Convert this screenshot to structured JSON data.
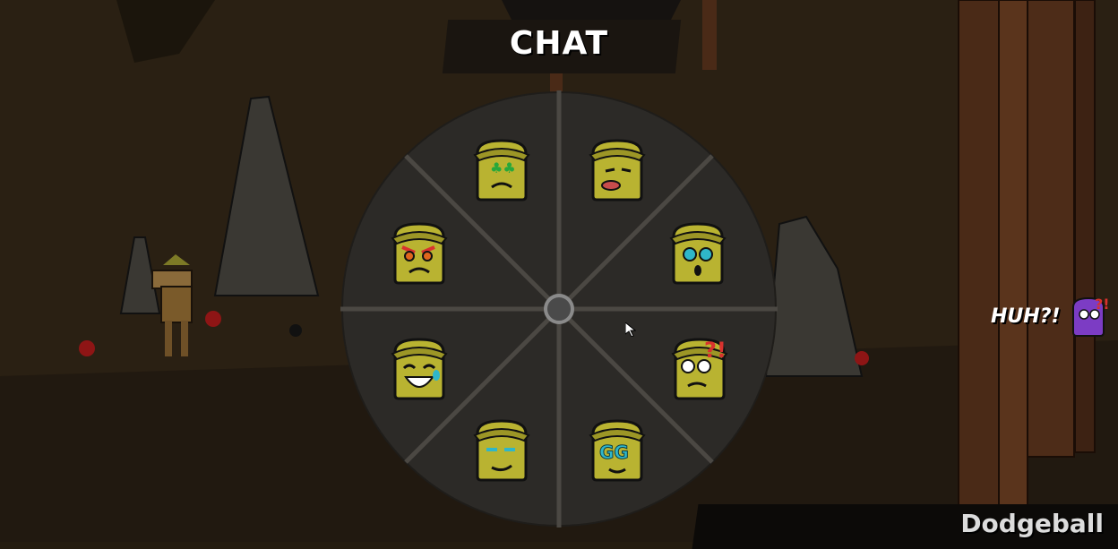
{
  "title": "CHAT",
  "game_mode": "Dodgeball",
  "chat_bubble": {
    "text": "HUH?!",
    "avatar": "purple-confused-avatar-icon"
  },
  "emotes": [
    {
      "name": "clover-eyes-emote"
    },
    {
      "name": "tongue-out-emote"
    },
    {
      "name": "sparkle-eyes-emote"
    },
    {
      "name": "confused-question-emote"
    },
    {
      "name": "gg-emote"
    },
    {
      "name": "smug-emote"
    },
    {
      "name": "laugh-cry-emote"
    },
    {
      "name": "angry-emote"
    }
  ],
  "colors": {
    "wheel": "#2c2a27",
    "emote_skin": "#b9b331",
    "accent": "#2fb6c9"
  }
}
